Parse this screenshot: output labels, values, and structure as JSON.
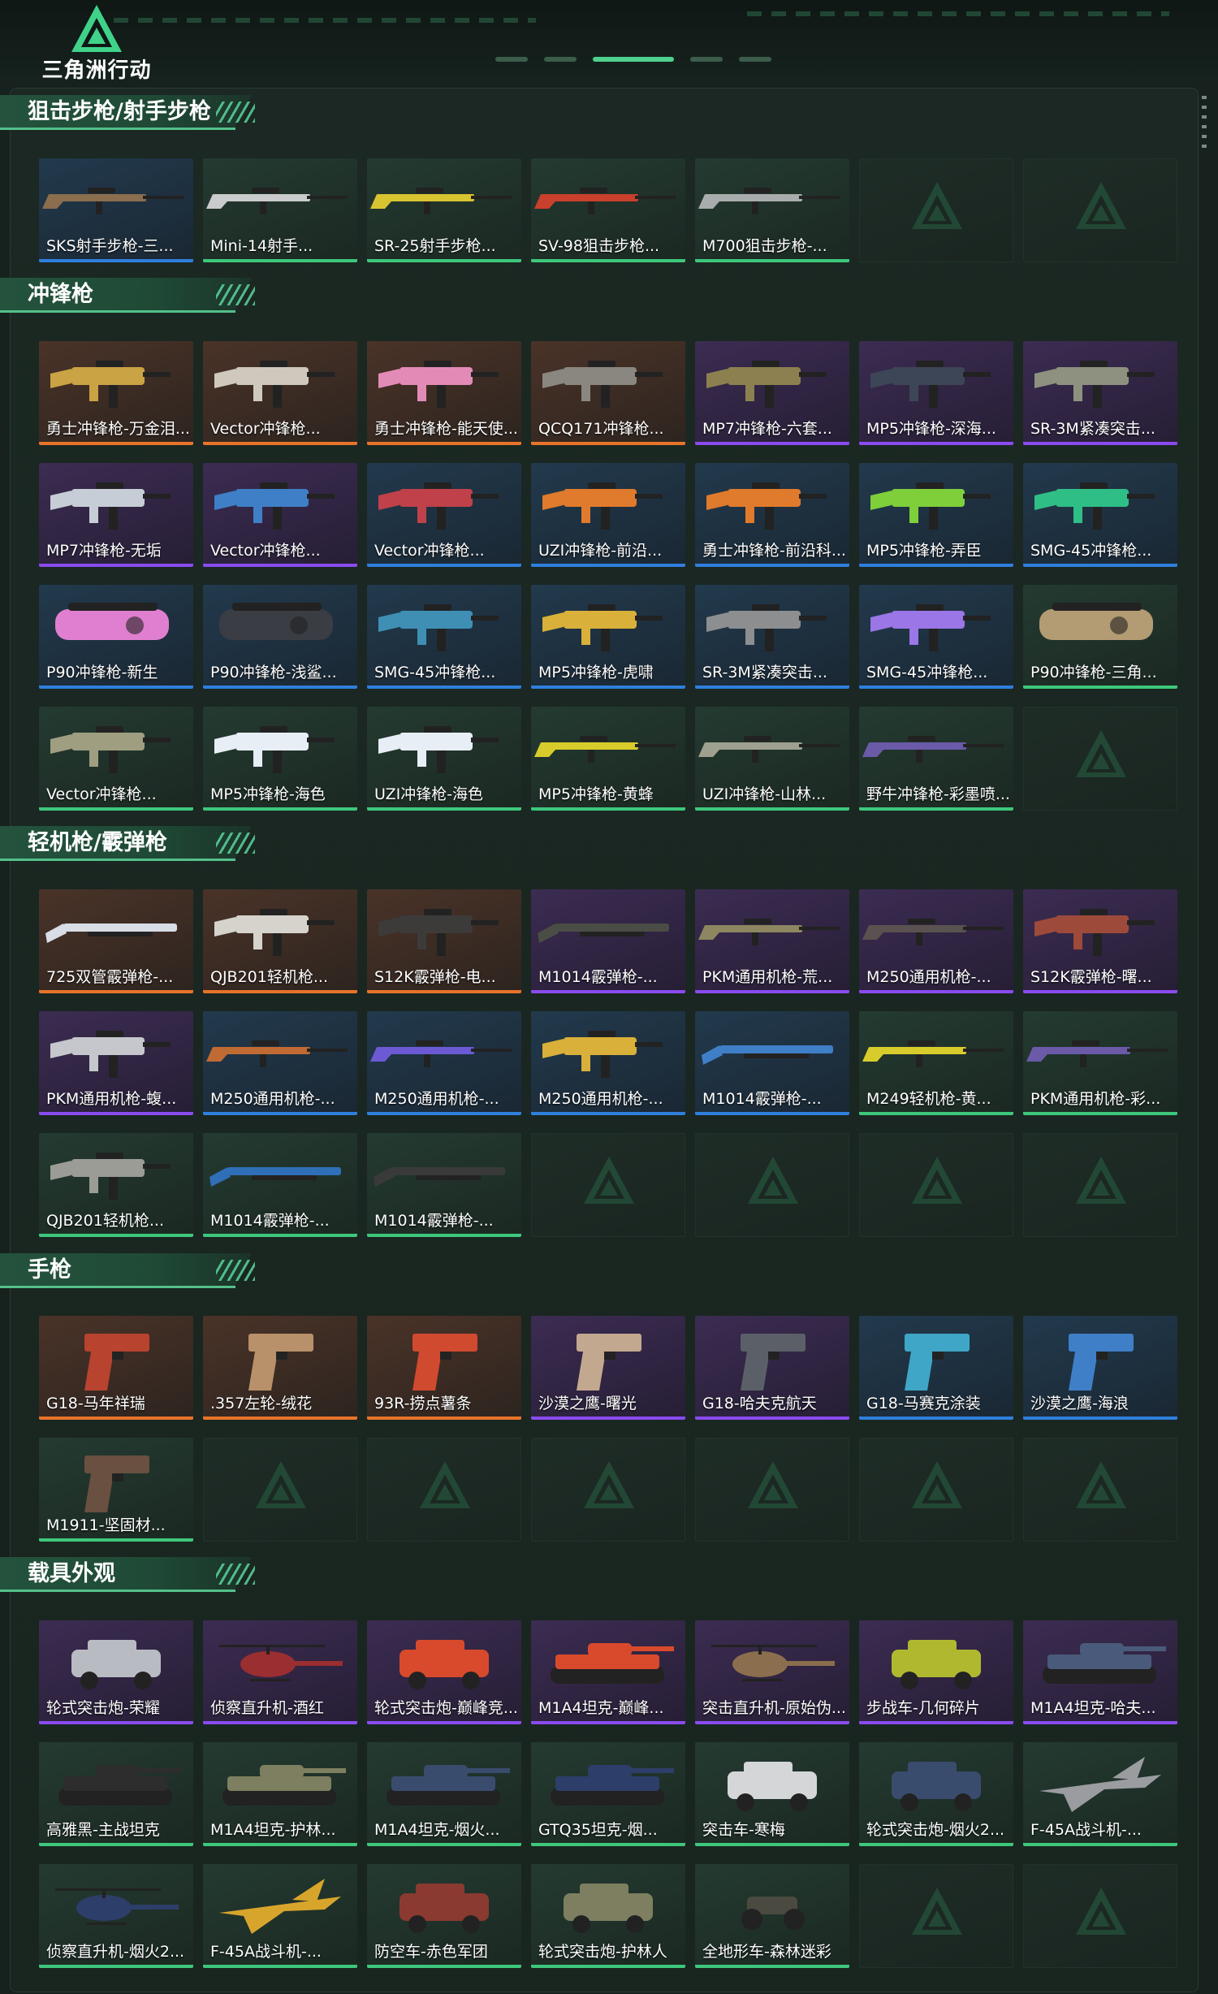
{
  "app": {
    "logo_text": "三角洲行动"
  },
  "colors": {
    "accent": "#54c08a",
    "orange": "#e8742a",
    "purple": "#8a4bf0",
    "blue": "#2f7fdc",
    "green": "#3ec77c"
  },
  "sections": [
    {
      "title": "狙击步枪/射手步枪",
      "items": [
        {
          "label": "SKS射手步枪-三...",
          "rarity": "blue",
          "kind": "rifle",
          "tint": "#8a6e4e"
        },
        {
          "label": "Mini-14射手...",
          "rarity": "green",
          "kind": "rifle",
          "tint": "#c9cbcc"
        },
        {
          "label": "SR-25射手步枪...",
          "rarity": "green",
          "kind": "rifle",
          "tint": "#d8c431"
        },
        {
          "label": "SV-98狙击步枪...",
          "rarity": "green",
          "kind": "rifle",
          "tint": "#c9402c"
        },
        {
          "label": "M700狙击步枪-...",
          "rarity": "green",
          "kind": "rifle",
          "tint": "#a9acad"
        },
        {
          "label": "",
          "rarity": "empty",
          "kind": "empty",
          "tint": ""
        },
        {
          "label": "",
          "rarity": "empty",
          "kind": "empty",
          "tint": ""
        }
      ]
    },
    {
      "title": "冲锋枪",
      "items": [
        {
          "label": "勇士冲锋枪-万金泪...",
          "rarity": "orange",
          "kind": "smg",
          "tint": "#c9a344"
        },
        {
          "label": "Vector冲锋枪...",
          "rarity": "orange",
          "kind": "smg",
          "tint": "#cfc9bd"
        },
        {
          "label": "勇士冲锋枪-能天使...",
          "rarity": "orange",
          "kind": "smg",
          "tint": "#e38bb7"
        },
        {
          "label": "QCQ171冲锋枪...",
          "rarity": "orange",
          "kind": "smg",
          "tint": "#8a8780"
        },
        {
          "label": "MP7冲锋枪-六套...",
          "rarity": "purple",
          "kind": "smg",
          "tint": "#8d8050"
        },
        {
          "label": "MP5冲锋枪-深海...",
          "rarity": "purple",
          "kind": "smg",
          "tint": "#3d4656"
        },
        {
          "label": "SR-3M紧凑突击...",
          "rarity": "purple",
          "kind": "smg",
          "tint": "#8e9180"
        },
        {
          "label": "MP7冲锋枪-无垢",
          "rarity": "purple",
          "kind": "smg",
          "tint": "#c7cdd6"
        },
        {
          "label": "Vector冲锋枪...",
          "rarity": "purple",
          "kind": "smg",
          "tint": "#3f7fc7"
        },
        {
          "label": "Vector冲锋枪...",
          "rarity": "blue",
          "kind": "smg",
          "tint": "#c0414a"
        },
        {
          "label": "UZI冲锋枪-前沿...",
          "rarity": "blue",
          "kind": "smg",
          "tint": "#e07a2c"
        },
        {
          "label": "勇士冲锋枪-前沿科...",
          "rarity": "blue",
          "kind": "smg",
          "tint": "#e07a2c"
        },
        {
          "label": "MP5冲锋枪-弄臣",
          "rarity": "blue",
          "kind": "smg",
          "tint": "#7fcf3b"
        },
        {
          "label": "SMG-45冲锋枪...",
          "rarity": "blue",
          "kind": "smg",
          "tint": "#2fbf86"
        },
        {
          "label": "P90冲锋枪-新生",
          "rarity": "blue",
          "kind": "p90",
          "tint": "#e07fd0"
        },
        {
          "label": "P90冲锋枪-浅鲨...",
          "rarity": "blue",
          "kind": "p90",
          "tint": "#3a3d44"
        },
        {
          "label": "SMG-45冲锋枪...",
          "rarity": "blue",
          "kind": "smg",
          "tint": "#3f8fb5"
        },
        {
          "label": "MP5冲锋枪-虎啸",
          "rarity": "blue",
          "kind": "smg",
          "tint": "#d9b039"
        },
        {
          "label": "SR-3M紧凑突击...",
          "rarity": "blue",
          "kind": "smg",
          "tint": "#8c8e90"
        },
        {
          "label": "SMG-45冲锋枪...",
          "rarity": "blue",
          "kind": "smg",
          "tint": "#9a76e6"
        },
        {
          "label": "P90冲锋枪-三角...",
          "rarity": "green",
          "kind": "p90",
          "tint": "#b39b73"
        },
        {
          "label": "Vector冲锋枪...",
          "rarity": "green",
          "kind": "smg",
          "tint": "#9f9e80"
        },
        {
          "label": "MP5冲锋枪-海色",
          "rarity": "green",
          "kind": "smg",
          "tint": "#e7eef5"
        },
        {
          "label": "UZI冲锋枪-海色",
          "rarity": "green",
          "kind": "smg",
          "tint": "#e7eef5"
        },
        {
          "label": "MP5冲锋枪-黄蜂",
          "rarity": "green",
          "kind": "rifle",
          "tint": "#d8cc2c"
        },
        {
          "label": "UZI冲锋枪-山林...",
          "rarity": "green",
          "kind": "rifle",
          "tint": "#9ea090"
        },
        {
          "label": "野牛冲锋枪-彩墨喷...",
          "rarity": "green",
          "kind": "rifle",
          "tint": "#6a5aa8"
        },
        {
          "label": "",
          "rarity": "empty",
          "kind": "empty",
          "tint": ""
        }
      ]
    },
    {
      "title": "轻机枪/霰弹枪",
      "items": [
        {
          "label": "725双管霰弹枪-...",
          "rarity": "orange",
          "kind": "shotgun",
          "tint": "#d8dde6"
        },
        {
          "label": "QJB201轻机枪...",
          "rarity": "orange",
          "kind": "smg",
          "tint": "#d6d3cd"
        },
        {
          "label": "S12K霰弹枪-电...",
          "rarity": "orange",
          "kind": "smg",
          "tint": "#3d3a3a"
        },
        {
          "label": "M1014霰弹枪-...",
          "rarity": "purple",
          "kind": "shotgun",
          "tint": "#4a4d45"
        },
        {
          "label": "PKM通用机枪-荒...",
          "rarity": "purple",
          "kind": "rifle",
          "tint": "#8d8660"
        },
        {
          "label": "M250通用机枪-...",
          "rarity": "purple",
          "kind": "rifle",
          "tint": "#5a5250"
        },
        {
          "label": "S12K霰弹枪-曙...",
          "rarity": "purple",
          "kind": "smg",
          "tint": "#9e4a3a"
        },
        {
          "label": "PKM通用机枪-蝮...",
          "rarity": "purple",
          "kind": "smg",
          "tint": "#c5c7cc"
        },
        {
          "label": "M250通用机枪-...",
          "rarity": "blue",
          "kind": "rifle",
          "tint": "#c06a34"
        },
        {
          "label": "M250通用机枪-...",
          "rarity": "blue",
          "kind": "rifle",
          "tint": "#6b5ad3"
        },
        {
          "label": "M250通用机枪-...",
          "rarity": "blue",
          "kind": "smg",
          "tint": "#d9b039"
        },
        {
          "label": "M1014霰弹枪-...",
          "rarity": "blue",
          "kind": "shotgun",
          "tint": "#3f7fc7"
        },
        {
          "label": "M249轻机枪-黄...",
          "rarity": "green",
          "kind": "rifle",
          "tint": "#d8cc2c"
        },
        {
          "label": "PKM通用机枪-彩...",
          "rarity": "green",
          "kind": "rifle",
          "tint": "#6a5aa8"
        },
        {
          "label": "QJB201轻机枪...",
          "rarity": "green",
          "kind": "smg",
          "tint": "#9a9c95"
        },
        {
          "label": "M1014霰弹枪-...",
          "rarity": "green",
          "kind": "shotgun",
          "tint": "#2f6fb7"
        },
        {
          "label": "M1014霰弹枪-...",
          "rarity": "green",
          "kind": "shotgun",
          "tint": "#3a3a3a"
        },
        {
          "label": "",
          "rarity": "empty",
          "kind": "empty",
          "tint": ""
        },
        {
          "label": "",
          "rarity": "empty",
          "kind": "empty",
          "tint": ""
        },
        {
          "label": "",
          "rarity": "empty",
          "kind": "empty",
          "tint": ""
        },
        {
          "label": "",
          "rarity": "empty",
          "kind": "empty",
          "tint": ""
        }
      ]
    },
    {
      "title": "手枪",
      "items": [
        {
          "label": "G18-马年祥瑞",
          "rarity": "orange",
          "kind": "pistol",
          "tint": "#b8432e"
        },
        {
          "label": ".357左轮-绒花",
          "rarity": "orange",
          "kind": "pistol",
          "tint": "#b8916a"
        },
        {
          "label": "93R-捞点薯条",
          "rarity": "orange",
          "kind": "pistol",
          "tint": "#d04a2f"
        },
        {
          "label": "沙漠之鹰-曙光",
          "rarity": "purple",
          "kind": "pistol",
          "tint": "#c2a88e"
        },
        {
          "label": "G18-哈夫克航天",
          "rarity": "purple",
          "kind": "pistol",
          "tint": "#5b6068"
        },
        {
          "label": "G18-马赛克涂装",
          "rarity": "blue",
          "kind": "pistol",
          "tint": "#3fa6c7"
        },
        {
          "label": "沙漠之鹰-海浪",
          "rarity": "blue",
          "kind": "pistol",
          "tint": "#3f7fc7"
        },
        {
          "label": "M1911-坚固材...",
          "rarity": "green",
          "kind": "pistol",
          "tint": "#6a5040"
        },
        {
          "label": "",
          "rarity": "empty",
          "kind": "empty",
          "tint": ""
        },
        {
          "label": "",
          "rarity": "empty",
          "kind": "empty",
          "tint": ""
        },
        {
          "label": "",
          "rarity": "empty",
          "kind": "empty",
          "tint": ""
        },
        {
          "label": "",
          "rarity": "empty",
          "kind": "empty",
          "tint": ""
        },
        {
          "label": "",
          "rarity": "empty",
          "kind": "empty",
          "tint": ""
        },
        {
          "label": "",
          "rarity": "empty",
          "kind": "empty",
          "tint": ""
        }
      ]
    },
    {
      "title": "载具外观",
      "items": [
        {
          "label": "轮式突击炮-荣耀",
          "rarity": "purple",
          "kind": "car",
          "tint": "#b8bcc2"
        },
        {
          "label": "侦察直升机-酒红",
          "rarity": "purple",
          "kind": "heli",
          "tint": "#9a2e30"
        },
        {
          "label": "轮式突击炮-巅峰竞...",
          "rarity": "purple",
          "kind": "car",
          "tint": "#d94a2c"
        },
        {
          "label": "M1A4坦克-巅峰...",
          "rarity": "purple",
          "kind": "tank",
          "tint": "#d94a2c"
        },
        {
          "label": "突击直升机-原始伪...",
          "rarity": "purple",
          "kind": "heli",
          "tint": "#8a6e4e"
        },
        {
          "label": "步战车-几何碎片",
          "rarity": "purple",
          "kind": "car",
          "tint": "#b0b830"
        },
        {
          "label": "M1A4坦克-哈夫...",
          "rarity": "purple",
          "kind": "tank",
          "tint": "#4a5a7a"
        },
        {
          "label": "高雅黑-主战坦克",
          "rarity": "green",
          "kind": "tank",
          "tint": "#2d2d2d"
        },
        {
          "label": "M1A4坦克-护林...",
          "rarity": "green",
          "kind": "tank",
          "tint": "#7d7f60"
        },
        {
          "label": "M1A4坦克-烟火...",
          "rarity": "green",
          "kind": "tank",
          "tint": "#3a4c6e"
        },
        {
          "label": "GTQ35坦克-烟...",
          "rarity": "green",
          "kind": "tank",
          "tint": "#2d3e6a"
        },
        {
          "label": "突击车-寒梅",
          "rarity": "green",
          "kind": "car",
          "tint": "#d4d6d8"
        },
        {
          "label": "轮式突击炮-烟火2...",
          "rarity": "green",
          "kind": "car",
          "tint": "#3a4c6e"
        },
        {
          "label": "F-45A战斗机-...",
          "rarity": "green",
          "kind": "jet",
          "tint": "#9a9ca0"
        },
        {
          "label": "侦察直升机-烟火2...",
          "rarity": "green",
          "kind": "heli",
          "tint": "#2d3e6a"
        },
        {
          "label": "F-45A战斗机-...",
          "rarity": "green",
          "kind": "jet",
          "tint": "#d8a52c"
        },
        {
          "label": "防空车-赤色军团",
          "rarity": "green",
          "kind": "car",
          "tint": "#8a3a30"
        },
        {
          "label": "轮式突击炮-护林人",
          "rarity": "green",
          "kind": "car",
          "tint": "#7d7f60"
        },
        {
          "label": "全地形车-森林迷彩",
          "rarity": "green",
          "kind": "atv",
          "tint": "#4a4a40"
        },
        {
          "label": "",
          "rarity": "empty",
          "kind": "empty",
          "tint": ""
        },
        {
          "label": "",
          "rarity": "empty",
          "kind": "empty",
          "tint": ""
        }
      ]
    }
  ]
}
